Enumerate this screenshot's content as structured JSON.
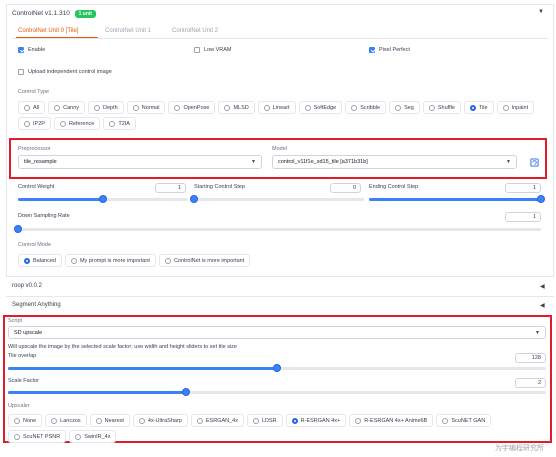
{
  "controlnet": {
    "title": "ControlNet v1.1.310",
    "badge": "1 unit",
    "tabs": [
      "ControlNet Unit 0 [Tile]",
      "ControlNet Unit 1",
      "ControlNet Unit 2"
    ],
    "enable_label": "Enable",
    "low_vram_label": "Low VRAM",
    "pixel_perfect_label": "Pixel Perfect",
    "upload_label": "Upload independent control image",
    "control_type_label": "Control Type",
    "control_types": [
      "All",
      "Canny",
      "Depth",
      "Normal",
      "OpenPose",
      "MLSD",
      "Lineart",
      "SoftEdge",
      "Scribble",
      "Seg",
      "Shuffle",
      "Tile",
      "Inpaint",
      "IP2P",
      "Reference",
      "T2IA"
    ],
    "control_type_selected": "Tile",
    "preprocessor_label": "Preprocessor",
    "preprocessor_value": "tile_resample",
    "model_label": "Model",
    "model_value": "control_v11f1e_sd15_tile [a371b31b]",
    "weight_label": "Control Weight",
    "weight_value": "1",
    "weight_fraction": 0.5,
    "start_label": "Starting Control Step",
    "start_value": "0",
    "start_fraction": 0.0,
    "end_label": "Ending Control Step",
    "end_value": "1",
    "end_fraction": 1.0,
    "downsample_label": "Down Sampling Rate",
    "downsample_value": "1",
    "downsample_fraction": 0.0,
    "mode_label": "Control Mode",
    "modes": [
      "Balanced",
      "My prompt is more important",
      "ControlNet is more important"
    ],
    "mode_selected": "Balanced"
  },
  "sections": {
    "roop": "roop v0.0.2",
    "segment": "Segment Anything"
  },
  "script": {
    "label": "Script",
    "value": "SD upscale",
    "info": "Will upscale the image by the selected scale factor; use width and height sliders to set tile size",
    "overlap_label": "Tile overlap",
    "overlap_value": "128",
    "overlap_fraction": 0.5,
    "scale_label": "Scale Factor",
    "scale_value": "2",
    "scale_fraction": 0.33,
    "upscaler_label": "Upscaler",
    "upscalers": [
      "None",
      "Lanczos",
      "Nearest",
      "4x-UltraSharp",
      "ESRGAN_4x",
      "LDSR",
      "R-ESRGAN 4x+",
      "R-ESRGAN 4x+ Anime6B",
      "ScuNET GAN",
      "ScuNET PSNR",
      "SwinIR_4x"
    ],
    "upscaler_selected": "R-ESRGAN 4x+"
  },
  "watermark": "为宇编程研究所",
  "colors": {
    "accent": "#3b82f6",
    "highlight": "#e11d2b",
    "tab_active": "#ea580c",
    "badge": "#22c55e"
  }
}
